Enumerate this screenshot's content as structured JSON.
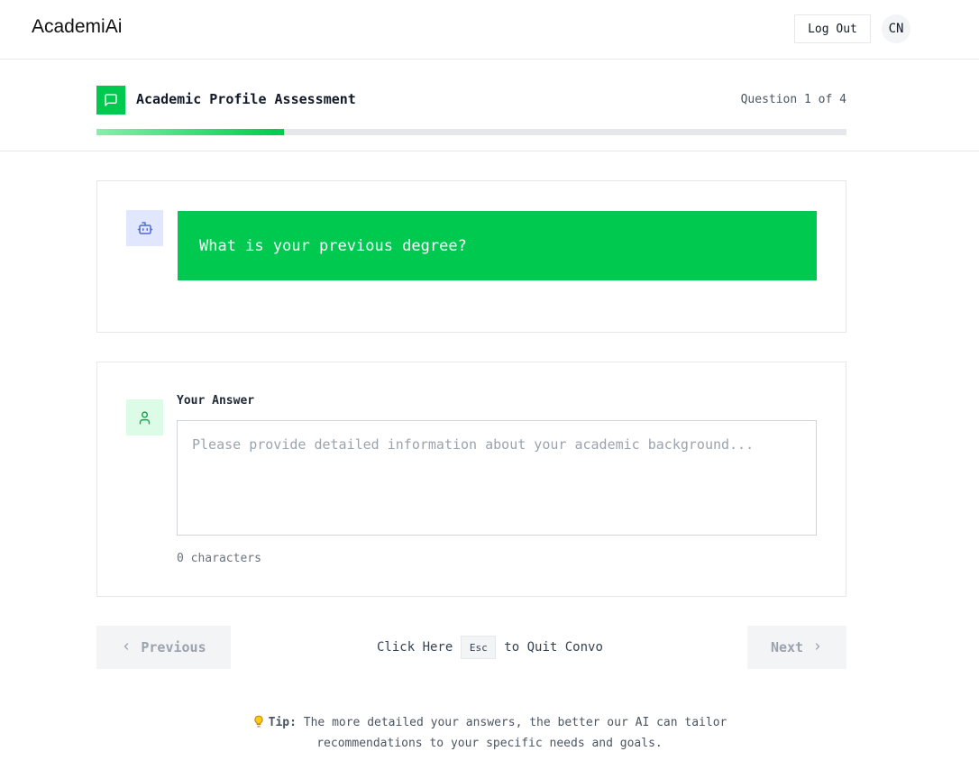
{
  "app": {
    "brand": "AcademiAi",
    "logout_label": "Log Out",
    "avatar_initials": "CN"
  },
  "header": {
    "title": "Academic Profile Assessment",
    "counter": "Question 1 of 4",
    "progress_fraction": 0.25
  },
  "question": {
    "text": "What is your previous degree?"
  },
  "answer": {
    "label": "Your Answer",
    "value": "",
    "placeholder": "Please provide detailed information about your academic background...",
    "char_count_text": "0 characters"
  },
  "nav": {
    "prev_label": "Previous",
    "next_label": "Next",
    "quit_prefix": "Click Here",
    "quit_key": "Esc",
    "quit_suffix": "to Quit Convo"
  },
  "tip": {
    "label": "Tip:",
    "text": "The more detailed your answers, the better our AI can tailor recommendations to your specific needs and goals."
  },
  "colors": {
    "accent": "#00c950",
    "accent_light": "#86efac",
    "bot_bg": "#e0e7ff",
    "user_bg": "#dcfce7",
    "tip_icon": "#facc15"
  },
  "icons": {
    "header": "message-square-icon",
    "question": "bot-icon",
    "answer": "user-icon",
    "tip": "lightbulb-icon",
    "prev": "chevron-left-icon",
    "next": "chevron-right-icon"
  }
}
